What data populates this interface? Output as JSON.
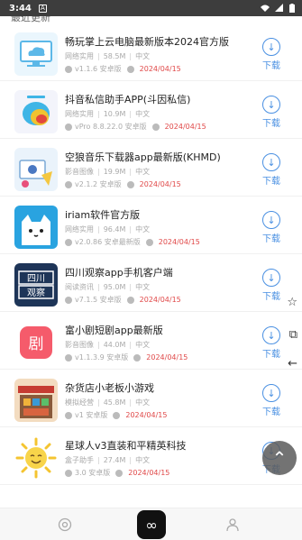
{
  "status_bar": {
    "time": "3:44",
    "sim_glyph": "A"
  },
  "section": {
    "title": "最近更新"
  },
  "download_label": "下载",
  "items": [
    {
      "title": "畅玩掌上云电脑最新版本2024官方版",
      "category": "网络实用",
      "size": "58.5M",
      "lang": "中文",
      "version": "v1.1.6 安卓版",
      "date": "2024/04/15",
      "icon": "cloud-icon"
    },
    {
      "title": "抖音私信助手APP(斗因私信)",
      "category": "网络实用",
      "size": "10.9M",
      "lang": "中文",
      "version": "vPro 8.8.22.0 安卓版",
      "date": "2024/04/15",
      "icon": "chat-icon"
    },
    {
      "title": "空狼音乐下载器app最新版(KHMD)",
      "category": "影音图像",
      "size": "19.9M",
      "lang": "中文",
      "version": "v2.1.2 安卓版",
      "date": "2024/04/15",
      "icon": "music-icon"
    },
    {
      "title": "iriam软件官方版",
      "category": "网络实用",
      "size": "96.4M",
      "lang": "中文",
      "version": "v2.0.86 安卓最新版",
      "date": "2024/04/15",
      "icon": "cat-icon"
    },
    {
      "title": "四川观察app手机客户端",
      "category": "阅读资讯",
      "size": "95.0M",
      "lang": "中文",
      "version": "v7.1.5 安卓版",
      "date": "2024/04/15",
      "icon": "sichuan-icon"
    },
    {
      "title": "富小剧短剧app最新版",
      "category": "影音图像",
      "size": "44.0M",
      "lang": "中文",
      "version": "v1.1.3.9 安卓版",
      "date": "2024/04/15",
      "icon": "drama-icon"
    },
    {
      "title": "杂货店小老板小游戏",
      "category": "模拟经营",
      "size": "45.8M",
      "lang": "中文",
      "version": "v1 安卓版",
      "date": "2024/04/15",
      "icon": "shop-icon"
    },
    {
      "title": "星球人v3直装和平精英科技",
      "category": "盒子助手",
      "size": "27.4M",
      "lang": "中文",
      "version": "3.0 安卓版",
      "date": "2024/04/15",
      "icon": "sun-icon"
    }
  ],
  "fab": {
    "icon": "arrow-up-icon"
  },
  "side_icons": [
    "star-icon",
    "link-icon",
    "back-icon"
  ],
  "tabs": [
    {
      "icon": "browser-icon"
    },
    {
      "icon": "infinity-icon"
    },
    {
      "icon": "user-icon"
    }
  ]
}
